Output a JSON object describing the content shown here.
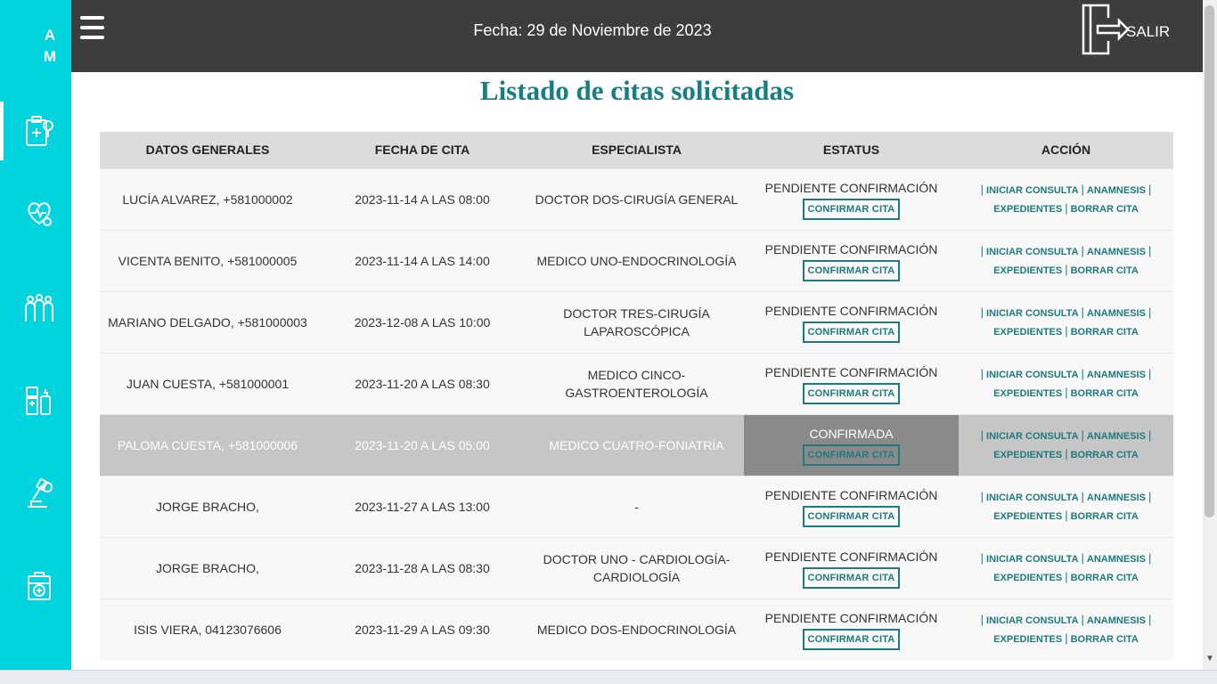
{
  "app": {
    "logo_text": "A M"
  },
  "header": {
    "date": "Fecha: 29 de Noviembre de 2023",
    "logout_label": "SALIR"
  },
  "page": {
    "title": "Listado de citas solicitadas"
  },
  "table": {
    "headers": [
      "DATOS GENERALES",
      "FECHA DE CITA",
      "ESPECIALISTA",
      "ESTATUS",
      "ACCIÓN"
    ],
    "confirm_label": "CONFIRMAR CITA",
    "actions": {
      "iniciar": "INICIAR CONSULTA",
      "anamnesis": "ANAMNESIS",
      "expedientes": "EXPEDIENTES",
      "borrar": "BORRAR CITA"
    },
    "rows": [
      {
        "datos": "LUCÍA ALVAREZ, +581000002",
        "fecha": "2023-11-14 A LAS 08:00",
        "especialista": "DOCTOR DOS-CIRUGÍA GENERAL",
        "estatus": "PENDIENTE CONFIRMACIÓN"
      },
      {
        "datos": "VICENTA BENITO, +581000005",
        "fecha": "2023-11-14 A LAS 14:00",
        "especialista": "MEDICO UNO-ENDOCRINOLOGÍA",
        "estatus": "PENDIENTE CONFIRMACIÓN"
      },
      {
        "datos": "MARIANO DELGADO, +581000003",
        "fecha": "2023-12-08 A LAS 10:00",
        "especialista": "DOCTOR TRES-CIRUGÍA LAPAROSCÓPICA",
        "estatus": "PENDIENTE CONFIRMACIÓN"
      },
      {
        "datos": "JUAN CUESTA, +581000001",
        "fecha": "2023-11-20 A LAS 08:30",
        "especialista": "MEDICO CINCO-GASTROENTEROLOGÍA",
        "estatus": "PENDIENTE CONFIRMACIÓN"
      },
      {
        "datos": "PALOMA CUESTA, +581000006",
        "fecha": "2023-11-20 A LAS 05:00",
        "especialista": "MEDICO CUATRO-FONIATRÍA",
        "estatus": "CONFIRMADA"
      },
      {
        "datos": "JORGE BRACHO,",
        "fecha": "2023-11-27 A LAS 13:00",
        "especialista": "-",
        "estatus": "PENDIENTE CONFIRMACIÓN"
      },
      {
        "datos": "JORGE BRACHO,",
        "fecha": "2023-11-28 A LAS 08:30",
        "especialista": "DOCTOR UNO - CARDIOLOGÍA-CARDIOLOGÍA",
        "estatus": "PENDIENTE CONFIRMACIÓN"
      },
      {
        "datos": "ISIS VIERA, 04123076606",
        "fecha": "2023-11-29 A LAS 09:30",
        "especialista": "MEDICO DOS-ENDOCRINOLOGÍA",
        "estatus": "PENDIENTE CONFIRMACIÓN"
      }
    ]
  },
  "sidebar": {
    "icons": [
      "clipboard-health-icon",
      "stethoscope-icon",
      "patients-group-icon",
      "pharmacy-icon",
      "microscope-icon",
      "medical-kit-icon"
    ]
  },
  "colors": {
    "sidebar": "#00d4de",
    "topbar": "#3d3d3d",
    "accent": "#177e83"
  }
}
